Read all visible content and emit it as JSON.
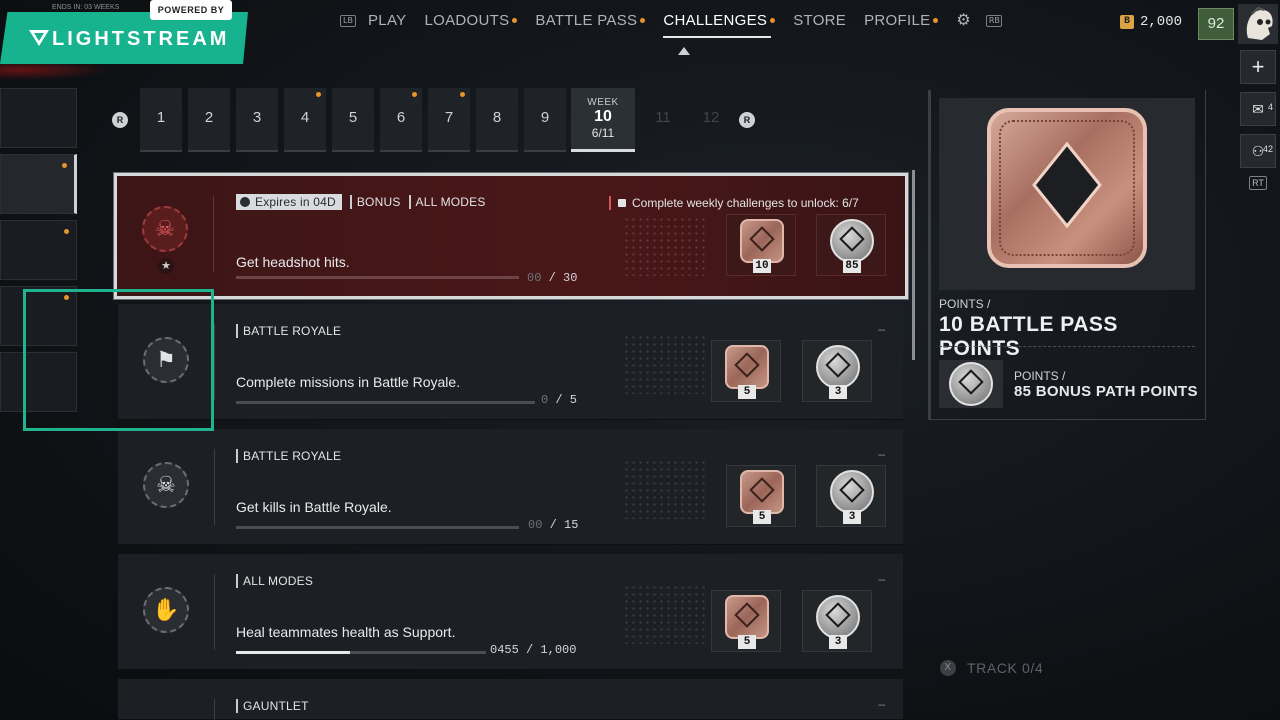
{
  "overlay": {
    "powered_by": "POWERED BY",
    "brand": "LIGHTSTREAM",
    "ends_text": "ENDS IN: 03 WEEKS"
  },
  "nav": {
    "lb": "LB",
    "rb": "RB",
    "items": [
      {
        "label": "PLAY",
        "dot": false,
        "active": false
      },
      {
        "label": "LOADOUTS",
        "dot": true,
        "active": false
      },
      {
        "label": "BATTLE PASS",
        "dot": true,
        "active": false
      },
      {
        "label": "CHALLENGES",
        "dot": true,
        "active": true
      },
      {
        "label": "STORE",
        "dot": false,
        "active": false
      },
      {
        "label": "PROFILE",
        "dot": true,
        "active": false
      }
    ],
    "currency": "2,000",
    "level": "92"
  },
  "sidebar_right": {
    "plus": "+",
    "mail_count": "4",
    "friends_count": "42",
    "rt": "RT"
  },
  "weeks": {
    "bumper": "R",
    "items": [
      {
        "label": "1",
        "dot": false
      },
      {
        "label": "2",
        "dot": false
      },
      {
        "label": "3",
        "dot": false
      },
      {
        "label": "4",
        "dot": true
      },
      {
        "label": "5",
        "dot": false
      },
      {
        "label": "6",
        "dot": true
      },
      {
        "label": "7",
        "dot": true
      },
      {
        "label": "8",
        "dot": false
      },
      {
        "label": "9",
        "dot": false
      }
    ],
    "active": {
      "kicker": "WEEK",
      "number": "10",
      "progress": "6/11"
    },
    "locked": [
      "11",
      "12"
    ]
  },
  "challenges": [
    {
      "selected": true,
      "expires": "Expires in 04D",
      "tags": [
        "BONUS",
        "ALL MODES"
      ],
      "lock_message": "Complete weekly challenges to unlock: 6/7",
      "description": "Get headshot hits.",
      "progress_current": "00",
      "progress_total": "/ 30",
      "fill": 0,
      "icon": "skull-crossbones",
      "rewards": [
        "10",
        "85"
      ]
    },
    {
      "selected": false,
      "tags": [
        "BATTLE ROYALE"
      ],
      "dash": "–",
      "description": "Complete missions in Battle Royale.",
      "progress_current": "0",
      "progress_total": "/ 5",
      "fill": 0,
      "icon": "flag",
      "rewards": [
        "5",
        "3"
      ]
    },
    {
      "selected": false,
      "tags": [
        "BATTLE ROYALE"
      ],
      "dash": "–",
      "description": "Get kills in Battle Royale.",
      "progress_current": "00",
      "progress_total": "/ 15",
      "fill": 0,
      "icon": "skull-crossbones",
      "rewards": [
        "5",
        "3"
      ]
    },
    {
      "selected": false,
      "tags": [
        "ALL MODES"
      ],
      "dash": "–",
      "description": "Heal teammates health as Support.",
      "progress_current": "0455",
      "progress_total": "/ 1,000",
      "fill": 0.455,
      "icon": "paw",
      "rewards": [
        "5",
        "3"
      ]
    },
    {
      "selected": false,
      "tags": [
        "GAUNTLET"
      ],
      "dash": "–",
      "description": "",
      "progress_current": "",
      "progress_total": "",
      "fill": 0,
      "icon": "emblem",
      "rewards": []
    }
  ],
  "reward_panel": {
    "kicker": "POINTS /",
    "title": "10 BATTLE PASS POINTS",
    "kicker2": "POINTS /",
    "title2": "85 BONUS PATH POINTS"
  },
  "track": {
    "button": "X",
    "label": "TRACK 0/4"
  }
}
